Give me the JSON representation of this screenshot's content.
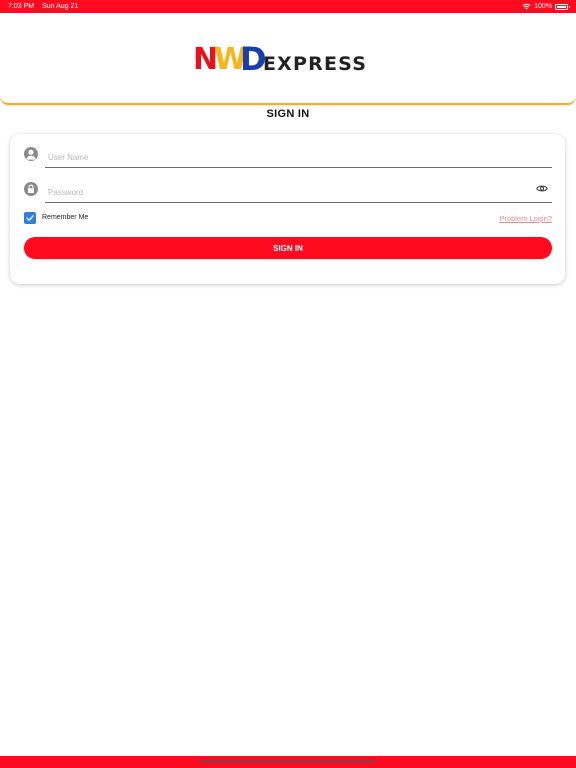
{
  "status_bar": {
    "time": "7:03 PM",
    "date": "Sun Aug 21",
    "battery": "100%",
    "color": "#ff0a1f"
  },
  "header": {
    "logo": {
      "n": "N",
      "w": "W",
      "d": "D",
      "express": "EXPRESS",
      "colors": {
        "n": "#e8111e",
        "w": "#f6b51a",
        "d": "#1b3faa",
        "express": "#222222"
      }
    },
    "accent_border": "#f2b01e"
  },
  "page_title": "SIGN IN",
  "form": {
    "username": {
      "placeholder": "User Name",
      "value": "",
      "icon": "user-icon"
    },
    "password": {
      "placeholder": "Password",
      "value": "",
      "icon": "lock-icon",
      "toggle_icon": "eye-icon"
    },
    "remember": {
      "label": "Remember Me",
      "checked": true
    },
    "problem_link": "Problem Login?",
    "submit_label": "SIGN IN"
  },
  "colors": {
    "primary": "#ff0a1f",
    "checkbox": "#2f7fe0",
    "link": "#e98a91"
  }
}
